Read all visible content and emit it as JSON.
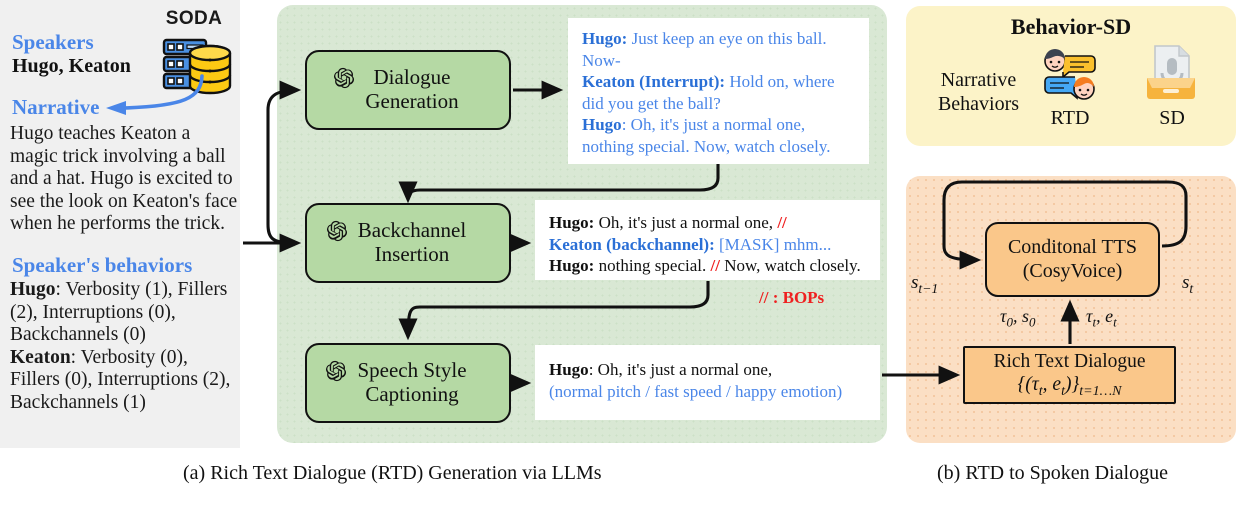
{
  "input_panel": {
    "speakers_title": "Speakers",
    "speakers_value": "Hugo, Keaton",
    "narrative_title": "Narrative",
    "narrative_text": "Hugo teaches Keaton a magic trick involving a ball and a hat. Hugo is excited to see the look on Keaton's face when he performs the trick.",
    "behaviors_title": "Speaker's behaviors",
    "behaviors_hugo_name": "Hugo",
    "behaviors_hugo_value": ": Verbosity (1), Fillers (2), Interruptions (0), Backchannels (0)",
    "behaviors_keaton_name": "Keaton",
    "behaviors_keaton_value": ": Verbosity (0), Fillers (0), Interruptions (2), Backchannels (1)",
    "soda_label": "SODA",
    "soda_icon": "database-server-icon",
    "narrative_arrow_icon": "curved-arrow-icon"
  },
  "panel_a": {
    "caption": "(a) Rich Text Dialogue (RTD) Generation via LLMs",
    "bops_legend": "// : BOPs",
    "steps": [
      {
        "label_line1": "Dialogue",
        "label_line2": "Generation",
        "icon": "openai-logo-icon"
      },
      {
        "label_line1": "Backchannel",
        "label_line2": "Insertion",
        "icon": "openai-logo-icon"
      },
      {
        "label_line1": "Speech Style",
        "label_line2": "Captioning",
        "icon": "openai-logo-icon"
      }
    ],
    "card_dialogue": {
      "l1_speaker": "Hugo:",
      "l1_text": " Just keep an eye on this ball. Now-",
      "l2_speaker": "Keaton (Interrupt):",
      "l2_text": " Hold on, where did you get the ball?",
      "l3_speaker": "Hugo",
      "l3_text": ": Oh, it's just a normal one, nothing special. Now, watch closely."
    },
    "card_backchannel": {
      "l1_speaker": "Hugo:",
      "l1_text": " Oh, it's just a normal one, ",
      "l1_mark": "//",
      "l2_speaker": "Keaton (backchannel):",
      "l2_text": " [MASK] mhm...",
      "l3_speaker": "Hugo:",
      "l3_text_a": " nothing special. ",
      "l3_mark": "//",
      "l3_text_b": " Now, watch closely."
    },
    "card_speech": {
      "l1_speaker": "Hugo",
      "l1_text": ": Oh, it's just a normal one,",
      "l2_caption": "(normal pitch / fast speed / happy emotion)"
    }
  },
  "panel_b": {
    "caption": "(b) RTD to Spoken Dialogue",
    "title": "Behavior-SD",
    "narrative_behaviors_label": "Narrative\nBehaviors",
    "rtd_icon": "two-speakers-chat-icon",
    "sd_icon": "microphone-document-icon",
    "rtd_caption": "RTD",
    "sd_caption": "SD",
    "tts_box_line1": "Conditonal TTS",
    "tts_box_line2": "(CosyVoice)",
    "rtd_box_line1": "Rich Text Dialogue",
    "rtd_box_line2_html": "{(τ<sub>t</sub>, e<sub>t</sub>)}<sub>t=1…N</sub>",
    "label_s_prev": "s",
    "label_s_prev_sub": "t−1",
    "label_s_cur": "s",
    "label_s_cur_sub": "t",
    "label_tau0_s0": "τ₀, s₀",
    "label_taut_et": "τₜ, eₜ"
  },
  "colors": {
    "panel_a_bg": "#d9e8d4",
    "llm_box_bg": "#b5d9a4",
    "panel_b_top_bg": "#fcf3c8",
    "panel_b_bot_bg": "#fbdfc4",
    "orange_box_bg": "#fac78a",
    "input_panel_bg": "#f0f0f0",
    "accent_blue": "#4a86e8",
    "dialogue_blue": "#4a86e8",
    "bops_red": "#ef2020"
  }
}
